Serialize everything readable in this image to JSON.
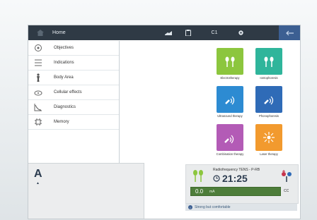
{
  "topbar": {
    "title": "Home",
    "channel": "C1"
  },
  "menu": {
    "items": [
      {
        "label": "Objectives",
        "icon": "objectives-icon"
      },
      {
        "label": "Indications",
        "icon": "indications-icon"
      },
      {
        "label": "Body Area",
        "icon": "body-area-icon"
      },
      {
        "label": "Cellular effects",
        "icon": "cellular-effects-icon"
      },
      {
        "label": "Diagnostics",
        "icon": "diagnostics-icon"
      },
      {
        "label": "Memory",
        "icon": "memory-icon"
      }
    ]
  },
  "tiles": [
    {
      "label": "Electrotherapy",
      "color": "#8cc63e"
    },
    {
      "label": "Iontophoresis",
      "color": "#2fb59b"
    },
    {
      "label": "Ultrasound therapy",
      "color": "#2d8bd2"
    },
    {
      "label": "Phonophoresis",
      "color": "#2f6bb7"
    },
    {
      "label": "Combination therapy",
      "color": "#b35bb6"
    },
    {
      "label": "Laser therapy",
      "color": "#f29a2e"
    }
  ],
  "left_panel": {
    "channel_letter": "A",
    "marker": "▲"
  },
  "status": {
    "program": "Radiofrequency TENS - P-RB",
    "time": "21:25",
    "value": "0.0",
    "unit": "mA",
    "mode": "CC",
    "info": "Strong but comfortable"
  }
}
